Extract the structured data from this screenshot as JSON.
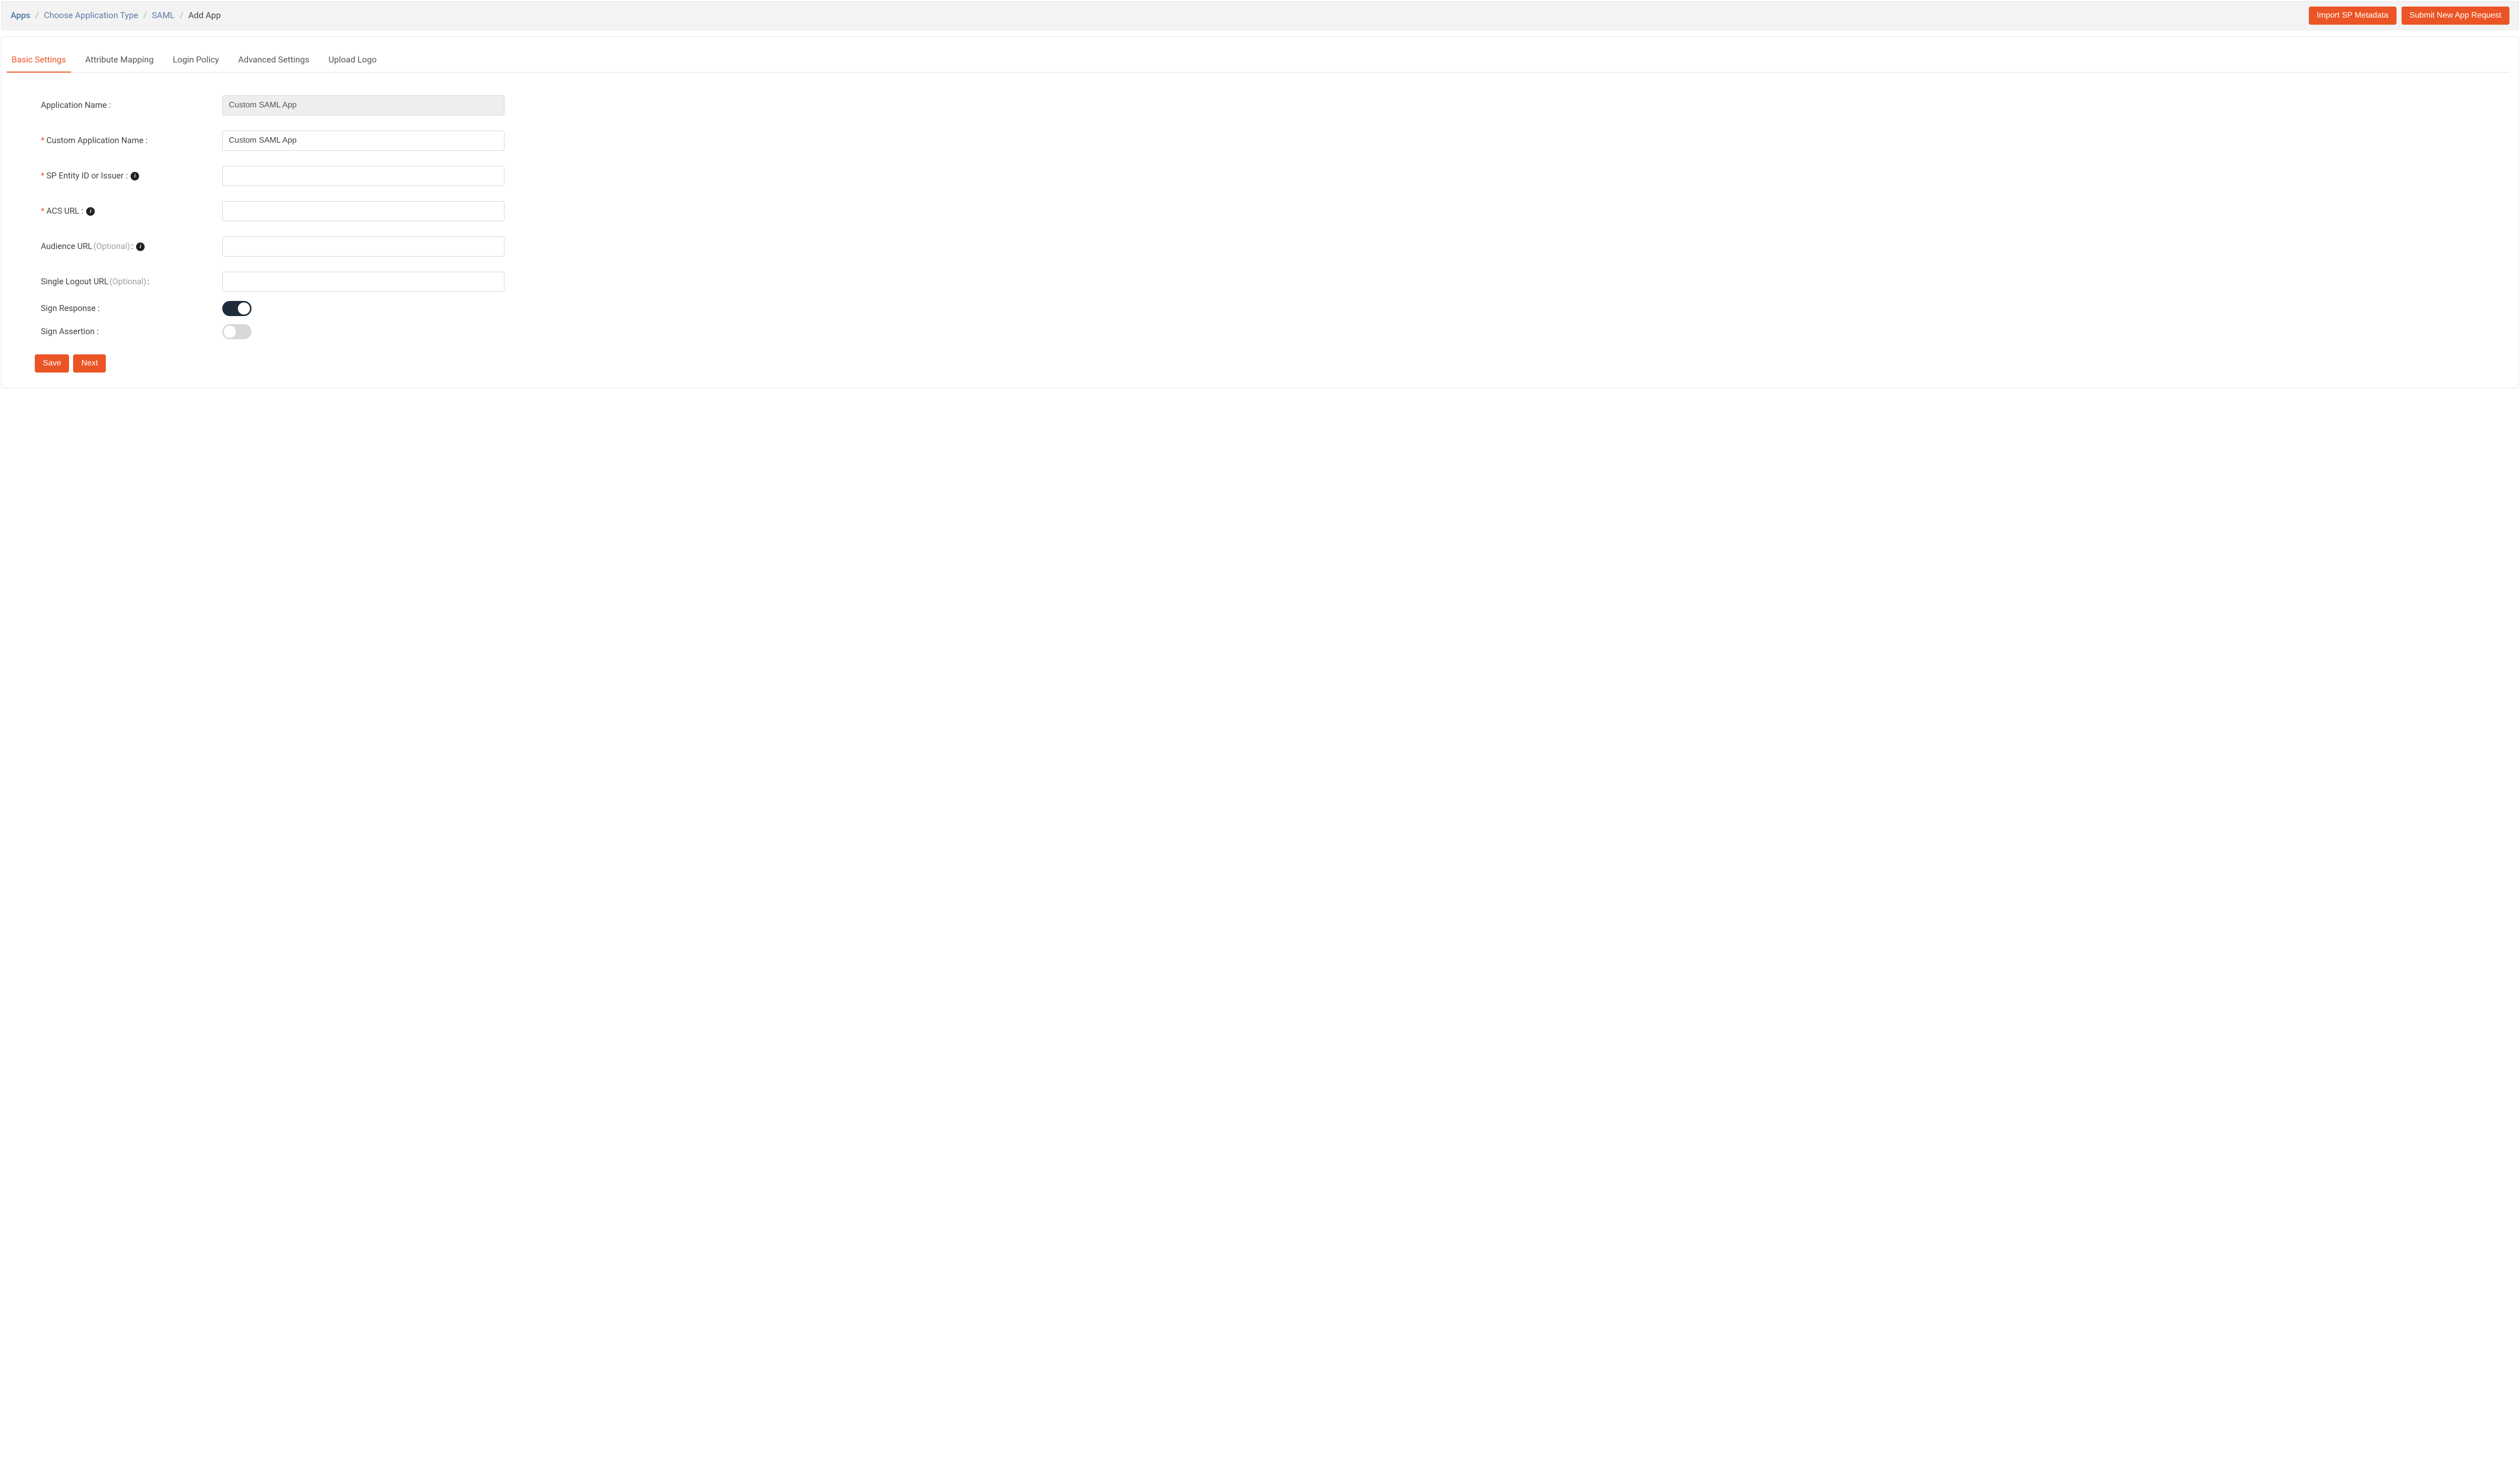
{
  "topbar": {
    "breadcrumb": {
      "apps": "Apps",
      "choose_type": "Choose Application Type",
      "saml": "SAML",
      "current": "Add App"
    },
    "buttons": {
      "import": "Import SP Metadata",
      "submit_request": "Submit New App Request"
    }
  },
  "tabs": {
    "basic": "Basic Settings",
    "attribute": "Attribute Mapping",
    "login_policy": "Login Policy",
    "advanced": "Advanced Settings",
    "upload_logo": "Upload Logo"
  },
  "form": {
    "app_name_label": "Application Name :",
    "app_name_value": "Custom SAML App",
    "custom_app_name_label": "Custom Application Name :",
    "custom_app_name_value": "Custom SAML App",
    "sp_entity_label": "SP Entity ID or Issuer :",
    "sp_entity_value": "",
    "acs_url_label": "ACS URL :",
    "acs_url_value": "",
    "audience_url_label": "Audience URL ",
    "audience_url_optional": "(Optional)",
    "audience_url_colon": " :",
    "audience_url_value": "",
    "slo_url_label": "Single Logout URL ",
    "slo_url_optional": "(Optional)",
    "slo_url_colon": " :",
    "slo_url_value": "",
    "sign_response_label": "Sign Response :",
    "sign_response_on": true,
    "sign_assertion_label": "Sign Assertion :",
    "sign_assertion_on": false
  },
  "actions": {
    "save": "Save",
    "next": "Next"
  },
  "icons": {
    "info": "i"
  }
}
